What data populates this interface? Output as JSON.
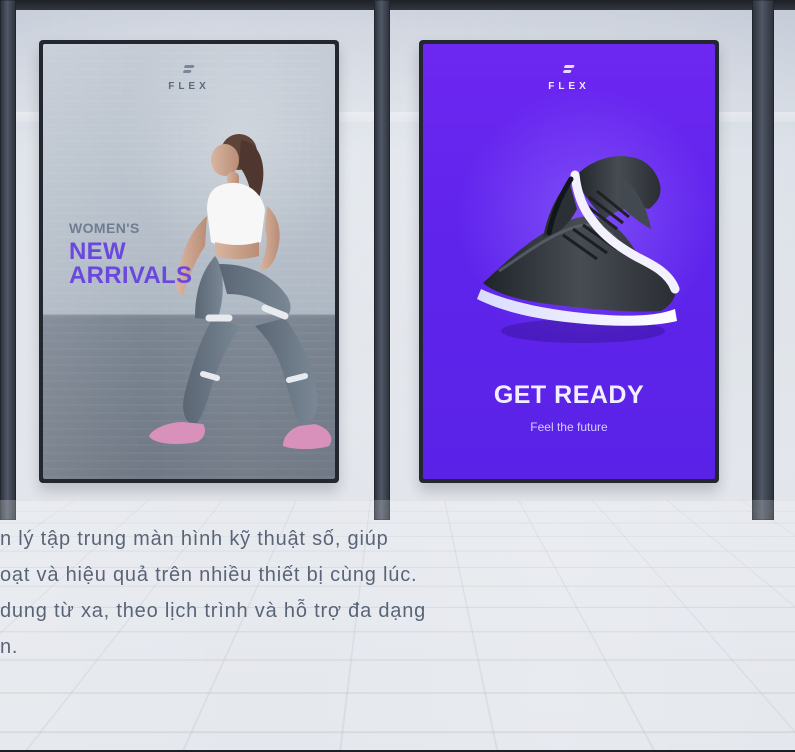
{
  "left_sign": {
    "brand": "FLEX",
    "kicker": "WOMEN'S",
    "headline_line1": "NEW",
    "headline_line2": "ARRIVALS"
  },
  "right_sign": {
    "brand": "FLEX",
    "headline": "GET READY",
    "tagline": "Feel the future"
  },
  "overlay": {
    "line1": "n lý tập trung màn hình kỹ thuật số, giúp",
    "line2": "oạt và hiệu quả trên nhiều thiết bị cùng lúc.",
    "line3": "dung từ xa, theo lịch trình và hỗ trợ đa dạng",
    "line4": "n."
  }
}
